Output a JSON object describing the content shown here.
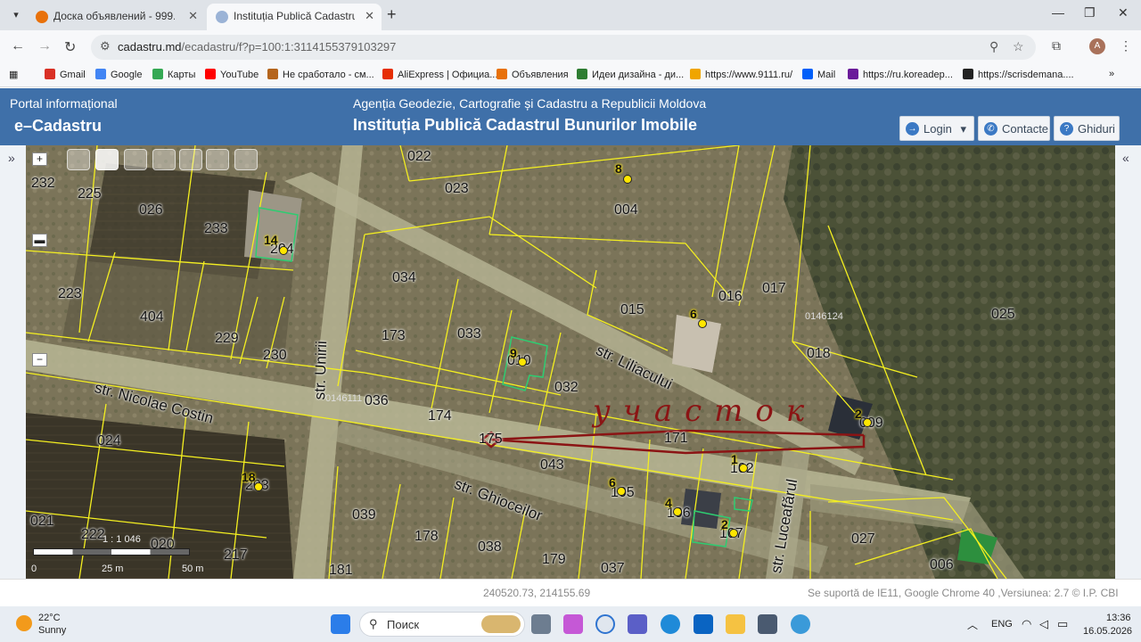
{
  "browser": {
    "tabs": [
      {
        "title": "Доска объявлений - 999.md",
        "active": false
      },
      {
        "title": "Instituția Publică Cadastrul Bunurilor Imobile",
        "active": true
      }
    ],
    "url_host": "cadastru.md",
    "url_path": "/ecadastru/f?p=100:1:3114155379103297",
    "profile_initial": "A"
  },
  "bookmarks": [
    {
      "label": "Gmail",
      "color": "#d93025"
    },
    {
      "label": "Google",
      "color": "#4285f4"
    },
    {
      "label": "Карты",
      "color": "#34a853"
    },
    {
      "label": "YouTube",
      "color": "#ff0000"
    },
    {
      "label": "Не сработало - см...",
      "color": "#b5651d"
    },
    {
      "label": "AliExpress | Официа...",
      "color": "#e62e04"
    },
    {
      "label": "Объявления",
      "color": "#e8710a"
    },
    {
      "label": "Идеи дизайна - ди...",
      "color": "#2e7d32"
    },
    {
      "label": "https://www.9111.ru/",
      "color": "#f0a500"
    },
    {
      "label": "Mail",
      "color": "#005ff9"
    },
    {
      "label": "https://ru.koreadep...",
      "color": "#6a1b9a"
    },
    {
      "label": "https://scrisdemana....",
      "color": "#222222"
    }
  ],
  "portal": {
    "top_left": "Portal informațional",
    "brand": "e–Cadastru",
    "agency": "Agenția Geodezie, Cartografie și Cadastru a Republicii Moldova",
    "institution": "Instituția Publică Cadastrul Bunurilor Imobile",
    "buttons": {
      "login": "Login",
      "contact": "Contacte",
      "guides": "Ghiduri"
    }
  },
  "map": {
    "parcels": [
      "022",
      "023",
      "004",
      "232",
      "225",
      "026",
      "233",
      "204",
      "223",
      "404",
      "229",
      "230",
      "034",
      "173",
      "033",
      "015",
      "016",
      "017",
      "025",
      "018",
      "036",
      "174",
      "032",
      "0146124",
      "0146111",
      "171",
      "043",
      "009",
      "102",
      "024",
      "203",
      "039",
      "178",
      "038",
      "179",
      "037",
      "105",
      "106",
      "107",
      "027",
      "006",
      "021",
      "222",
      "020",
      "217",
      "181",
      "175",
      "010",
      "105"
    ],
    "streets": [
      "str. Nicolae Costin",
      "str. Unirii",
      "str. Liliacului",
      "str. Ghioceilor",
      "str. Luceafărul"
    ],
    "markers": [
      "8",
      "14",
      "9",
      "6",
      "2",
      "1",
      "6",
      "4",
      "2",
      "18"
    ],
    "annotation": "участок",
    "scale_ratio": "1 : 1 046",
    "scale_ticks": [
      "0",
      "25 m",
      "50 m"
    ]
  },
  "status": {
    "coordinates": "240520.73, 214155.69",
    "support": "Se suportă de IE11, Google Chrome 40 ,Versiunea: 2.7 © I.P. CBI"
  },
  "taskbar": {
    "temperature": "22°C",
    "weather": "Sunny",
    "search": "Поиск",
    "language": "ENG",
    "time": "13:36",
    "date": "16.05.2026"
  }
}
